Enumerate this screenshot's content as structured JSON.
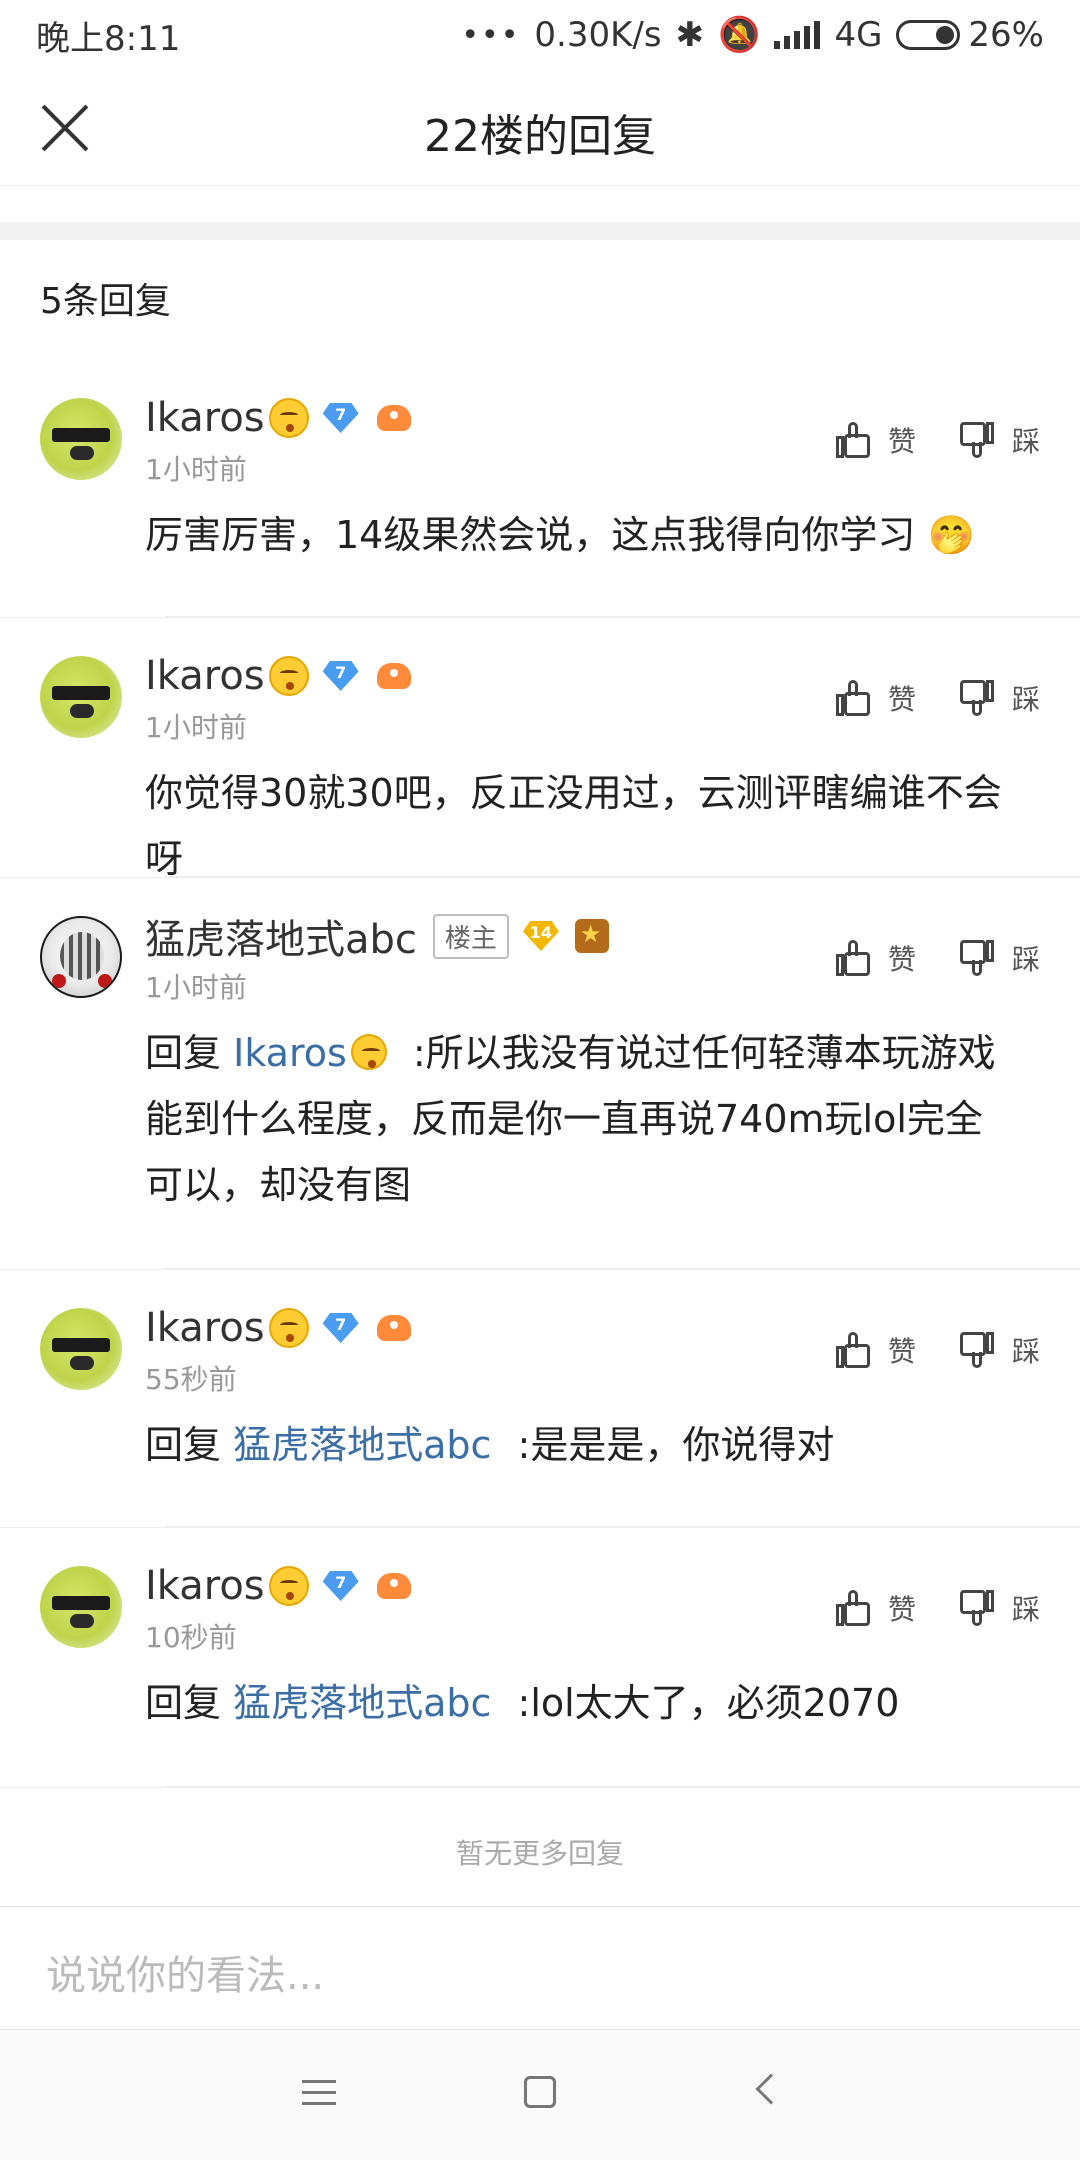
{
  "status_bar": {
    "time": "晚上8:11",
    "network_speed": "0.30K/s",
    "network_type": "4G",
    "battery_percent": "26%"
  },
  "header": {
    "title": "22楼的回复"
  },
  "reply_count": "5条回复",
  "actions": {
    "like": "赞",
    "dislike": "踩"
  },
  "replies": [
    {
      "user": "Ikaros",
      "level": "7",
      "time": "1小时前",
      "mention": "",
      "text": "厉害厉害，14级果然会说，这点我得向你学习"
    },
    {
      "user": "Ikaros",
      "level": "7",
      "time": "1小时前",
      "mention": "",
      "text": "你觉得30就30吧，反正没用过，云测评瞎编谁不会呀"
    },
    {
      "user": "猛虎落地式abc",
      "level": "14",
      "tag": "楼主",
      "time": "1小时前",
      "reply_prefix": "回复",
      "mention": "Ikaros",
      "text": ":所以我没有说过任何轻薄本玩游戏能到什么程度，反而是你一直再说740m玩lol完全可以，却没有图"
    },
    {
      "user": "Ikaros",
      "level": "7",
      "time": "55秒前",
      "reply_prefix": "回复",
      "mention": "猛虎落地式abc",
      "text": ":是是是，你说得对"
    },
    {
      "user": "Ikaros",
      "level": "7",
      "time": "10秒前",
      "reply_prefix": "回复",
      "mention": "猛虎落地式abc",
      "text": ":lol太大了，必须2070"
    }
  ],
  "footer": {
    "no_more": "暂无更多回复",
    "input_placeholder": "说说你的看法..."
  },
  "colors": {
    "mention": "#3a6ea5",
    "diamond_blue": "#4a9cf0",
    "diamond_gold": "#f5b800"
  }
}
